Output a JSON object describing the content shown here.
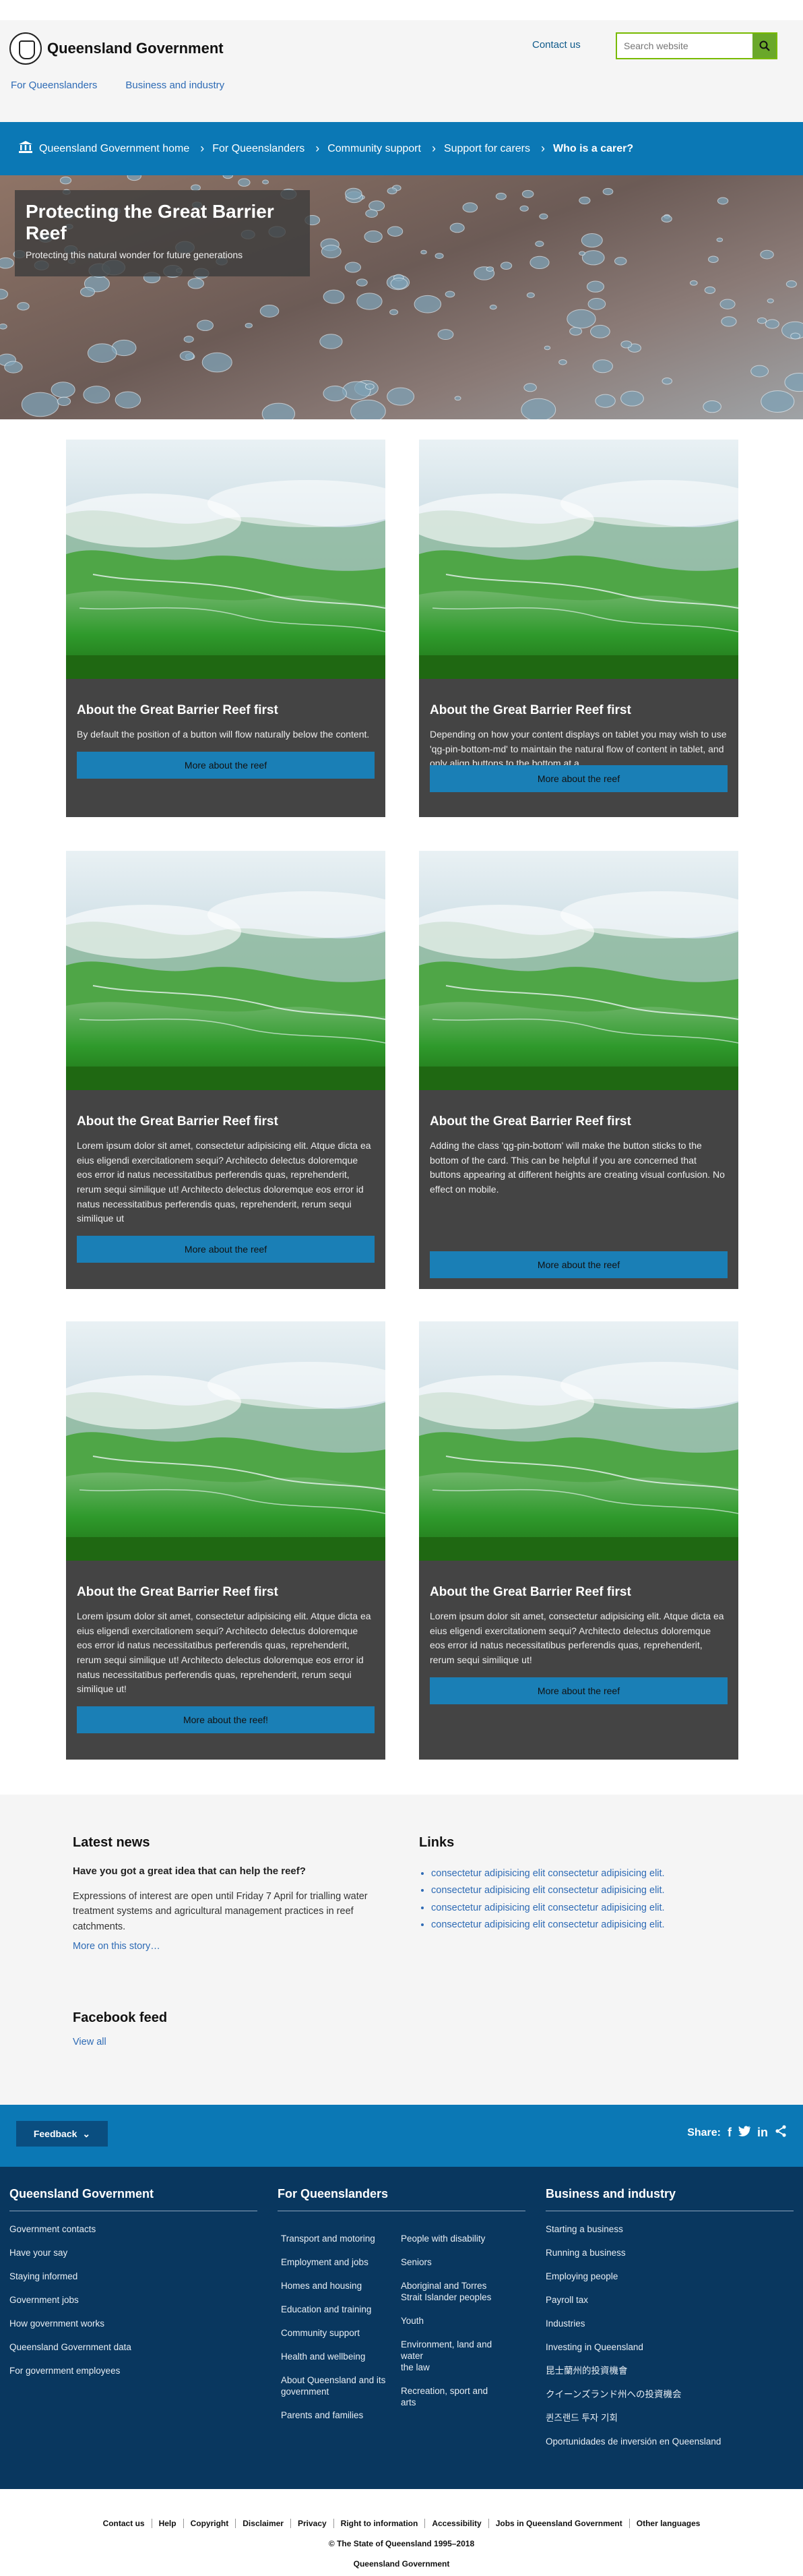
{
  "header": {
    "logo_text": "Queensland Government",
    "contact_label": "Contact us",
    "search_placeholder": "Search website",
    "nav": [
      "For Queenslanders",
      "Business and industry"
    ]
  },
  "breadcrumb": [
    "Queensland Government home",
    "For Queenslanders",
    "Community support",
    "Support for carers",
    "Who is a carer?"
  ],
  "hero": {
    "title": "Protecting the Great Barrier Reef",
    "subtitle": "Protecting this natural wonder for future generations"
  },
  "cards": [
    {
      "title": "About the Great Barrier Reef first",
      "text": "By default the position of a button will flow naturally below the content.",
      "button": "More about the reef"
    },
    {
      "title": "About the Great Barrier Reef first",
      "text": "Depending on how your content displays on tablet you may wish to use 'qg-pin-bottom-md' to maintain the natural flow of content in tablet, and only align buttons to the bottom at a",
      "button": "More about the reef"
    },
    {
      "title": "About the Great Barrier Reef first",
      "text": "Lorem ipsum dolor sit amet, consectetur adipisicing elit. Atque dicta ea eius eligendi exercitationem sequi? Architecto delectus doloremque eos error id natus necessitatibus perferendis quas, reprehenderit, rerum sequi similique ut! Architecto delectus doloremque eos error id natus necessitatibus perferendis quas, reprehenderit, rerum sequi similique ut",
      "button": "More about the reef"
    },
    {
      "title": "About the Great Barrier Reef first",
      "text": "Adding the class 'qg-pin-bottom' will make the button sticks to the bottom of the card. This can be helpful if you are concerned that buttons appearing at different heights are creating visual confusion. No effect on mobile.",
      "button": "More about the reef"
    },
    {
      "title": "About the Great Barrier Reef first",
      "text": "Lorem ipsum dolor sit amet, consectetur adipisicing elit. Atque dicta ea eius eligendi exercitationem sequi? Architecto delectus doloremque eos error id natus necessitatibus perferendis quas, reprehenderit, rerum sequi similique ut! Architecto delectus doloremque eos error id natus necessitatibus perferendis quas, reprehenderit, rerum sequi similique ut!",
      "button": "More about the reef!"
    },
    {
      "title": "About the Great Barrier Reef first",
      "text": "Lorem ipsum dolor sit amet, consectetur adipisicing elit. Atque dicta ea eius eligendi exercitationem sequi? Architecto delectus doloremque eos error id natus necessitatibus perferendis quas, reprehenderit, rerum sequi similique ut!",
      "button": "More about the reef"
    }
  ],
  "news": {
    "heading": "Latest news",
    "question": "Have you got a great idea that can help the reef?",
    "paragraph": "Expressions of interest are open until Friday 7 April for trialling water treatment systems and agricultural management practices in reef catchments.",
    "more": "More on this story…"
  },
  "links": {
    "heading": "Links",
    "items": [
      "consectetur adipisicing elit consectetur adipisicing elit.",
      "consectetur adipisicing elit consectetur adipisicing elit.",
      "consectetur adipisicing elit consectetur adipisicing elit.",
      "consectetur adipisicing elit consectetur adipisicing elit."
    ]
  },
  "facebook": {
    "heading": "Facebook feed",
    "view_all": "View all"
  },
  "feedback_bar": {
    "feedback_label": "Feedback",
    "share_label": "Share:"
  },
  "footer": {
    "col1": {
      "heading": "Queensland Government",
      "items": [
        "Government contacts",
        "Have your say",
        "Staying informed",
        "Government jobs",
        "How government works",
        "Queensland Government data",
        "For government employees"
      ]
    },
    "col2": {
      "heading": "For Queenslanders",
      "left": [
        "Transport and motoring",
        "Employment and jobs",
        "Homes and housing",
        "Education and training",
        "Community support",
        "Health and wellbeing",
        "About Queensland and its government",
        "Parents and families"
      ],
      "right": [
        "People with disability",
        "Seniors",
        "Aboriginal and Torres Strait Islander peoples",
        "Youth",
        "Environment, land and water",
        "the law",
        "Recreation, sport and arts"
      ]
    },
    "col3": {
      "heading": "Business and industry",
      "items": [
        "Starting a business",
        "Running a business",
        "Employing people",
        "Payroll tax",
        "Industries",
        "Investing in Queensland",
        "昆士蘭州的投資機會",
        "クイーンズランド州への投資機会",
        "퀸즈랜드 투자 기회",
        "Oportunidades de inversión en Queensland"
      ]
    }
  },
  "bottom": {
    "links": [
      "Contact us",
      "Help",
      "Copyright",
      "Disclaimer",
      "Privacy",
      "Right to information",
      "Accessibility",
      "Jobs in Queensland Government",
      "Other languages"
    ],
    "copyright": "© The State of Queensland 1995–2018",
    "org": "Queensland Government"
  }
}
